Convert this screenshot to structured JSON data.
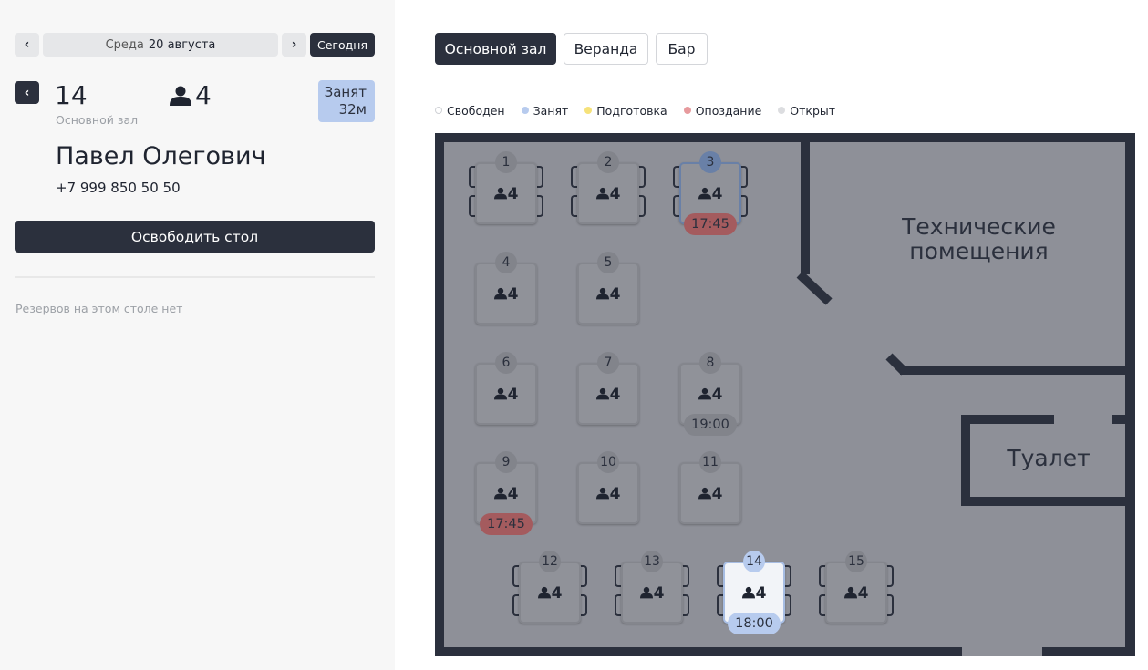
{
  "sidebar": {
    "prev_day_icon": "chevron-left-icon",
    "next_day_icon": "chevron-right-icon",
    "weekday": "Среда",
    "date": "20 августа",
    "today_label": "Сегодня",
    "back_icon": "chevron-left-icon",
    "table_number": "14",
    "hall_name": "Основной зал",
    "guests_count": "4",
    "status_label": "Занят",
    "status_duration": "32м",
    "guest_name": "Павел Олегович",
    "guest_phone": "+7 999 850 50 50",
    "free_table_label": "Освободить стол",
    "no_reservations_text": "Резервов на этом столе нет"
  },
  "hall_tabs": [
    {
      "label": "Основной зал",
      "active": true
    },
    {
      "label": "Веранда",
      "active": false
    },
    {
      "label": "Бар",
      "active": false
    }
  ],
  "legend": [
    {
      "label": "Свободен",
      "color": "#ffffff"
    },
    {
      "label": "Занят",
      "color": "#b7cbee"
    },
    {
      "label": "Подготовка",
      "color": "#f6e27a"
    },
    {
      "label": "Опоздание",
      "color": "#e79a9d"
    },
    {
      "label": "Открыт",
      "color": "#dcdde0"
    }
  ],
  "rooms": {
    "technical": "Технические помещения",
    "toilet": "Туалет"
  },
  "tables": [
    {
      "number": "1",
      "guests": "4",
      "time": null,
      "state": "free"
    },
    {
      "number": "2",
      "guests": "4",
      "time": null,
      "state": "free"
    },
    {
      "number": "3",
      "guests": "4",
      "time": "17:45",
      "state": "occupied-late"
    },
    {
      "number": "4",
      "guests": "4",
      "time": null,
      "state": "free"
    },
    {
      "number": "5",
      "guests": "4",
      "time": null,
      "state": "free"
    },
    {
      "number": "6",
      "guests": "4",
      "time": null,
      "state": "free"
    },
    {
      "number": "7",
      "guests": "4",
      "time": null,
      "state": "free"
    },
    {
      "number": "8",
      "guests": "4",
      "time": "19:00",
      "state": "reserved"
    },
    {
      "number": "9",
      "guests": "4",
      "time": "17:45",
      "state": "late"
    },
    {
      "number": "10",
      "guests": "4",
      "time": null,
      "state": "free"
    },
    {
      "number": "11",
      "guests": "4",
      "time": null,
      "state": "free"
    },
    {
      "number": "12",
      "guests": "4",
      "time": null,
      "state": "free"
    },
    {
      "number": "13",
      "guests": "4",
      "time": null,
      "state": "free"
    },
    {
      "number": "14",
      "guests": "4",
      "time": "18:00",
      "state": "selected"
    },
    {
      "number": "15",
      "guests": "4",
      "time": null,
      "state": "free"
    }
  ]
}
